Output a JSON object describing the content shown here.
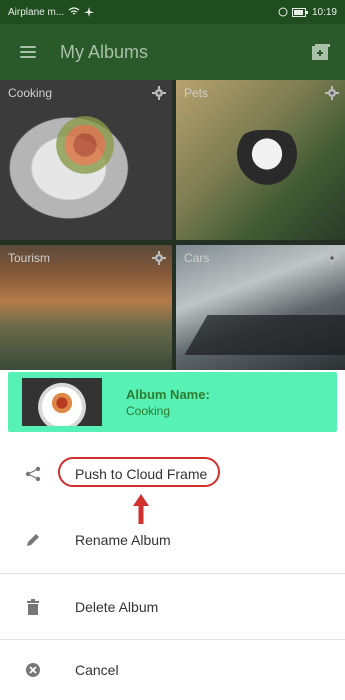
{
  "status_bar": {
    "left_text": "Airplane m...",
    "right_time": "10:19"
  },
  "app_bar": {
    "title": "My Albums"
  },
  "albums": [
    {
      "label": "Cooking"
    },
    {
      "label": "Pets"
    },
    {
      "label": "Tourism"
    },
    {
      "label": "Cars"
    }
  ],
  "bottom_sheet": {
    "album_name_label": "Album Name:",
    "album_name_value": "Cooking",
    "items": [
      {
        "label": "Push to Cloud Frame",
        "icon": "share-icon"
      },
      {
        "label": "Rename Album",
        "icon": "pencil-icon"
      },
      {
        "label": "Delete Album",
        "icon": "trash-icon"
      },
      {
        "label": "Cancel",
        "icon": "cancel-icon"
      }
    ]
  },
  "colors": {
    "app_bar": "#2a5a2a",
    "sheet_header": "#57f0b5",
    "highlight": "#d0312d"
  }
}
